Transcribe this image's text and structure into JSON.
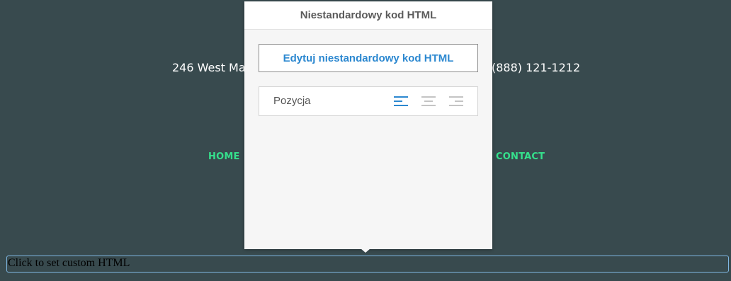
{
  "background": {
    "address_left": "246 West Ma",
    "address_right": "(888) 121-1212",
    "nav": {
      "home": "HOME",
      "contact": "CONTACT"
    }
  },
  "popup": {
    "title": "Niestandardowy kod HTML",
    "edit_button": "Edytuj niestandardowy kod HTML",
    "position_label": "Pozycja",
    "alignment_options": [
      "align-left",
      "align-center",
      "align-right"
    ],
    "selected_alignment": "align-left"
  },
  "custom_html_block": {
    "text": "Click to set custom HTML"
  },
  "colors": {
    "background": "#384a4e",
    "nav_accent": "#35e08c",
    "primary_blue": "#2c88d0",
    "inactive_icon": "#c4c4c4"
  }
}
